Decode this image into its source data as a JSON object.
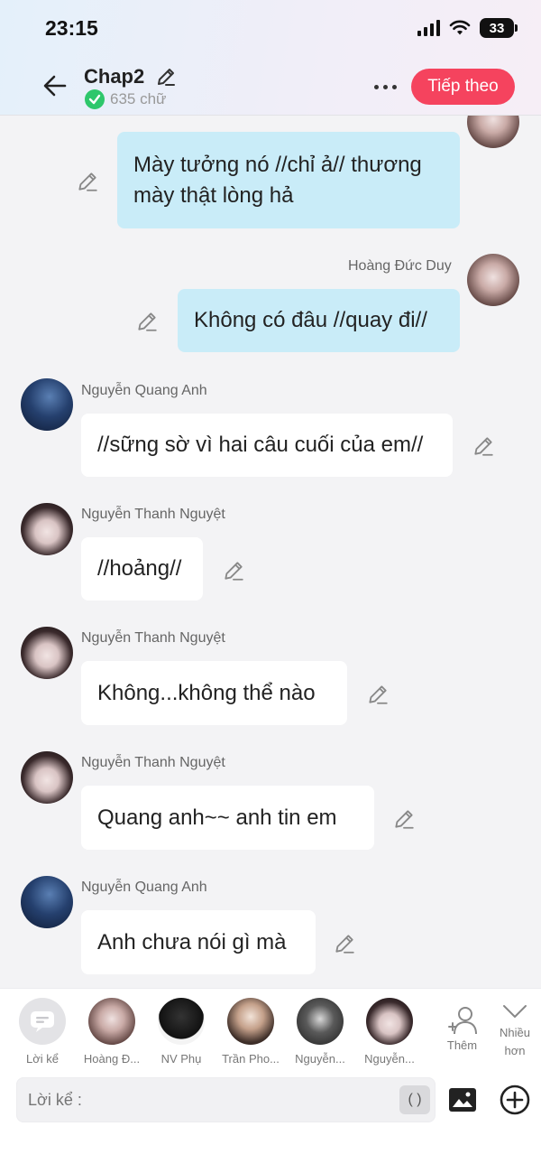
{
  "status_bar": {
    "time": "23:15",
    "battery": "33"
  },
  "header": {
    "title": "Chap2",
    "word_count": "635 chữ",
    "next_label": "Tiếp theo"
  },
  "messages": [
    {
      "side": "right",
      "sender": "",
      "text": "Mày tưởng nó //chỉ ả// thương mày thật lòng hả"
    },
    {
      "side": "right",
      "sender": "Hoàng Đức Duy",
      "text": "Không có đâu //quay đi//"
    },
    {
      "side": "left",
      "sender": "Nguyễn Quang Anh",
      "text": "//sững sờ vì hai câu cuối của em//"
    },
    {
      "side": "left",
      "sender": "Nguyễn Thanh Nguyệt",
      "text": "//hoảng//"
    },
    {
      "side": "left",
      "sender": "Nguyễn Thanh Nguyệt",
      "text": "Không...không thể nào"
    },
    {
      "side": "left",
      "sender": "Nguyễn Thanh Nguyệt",
      "text": "Quang anh~~ anh tin em"
    },
    {
      "side": "left",
      "sender": "Nguyễn Quang Anh",
      "text": "Anh chưa nói gì mà"
    }
  ],
  "characters": [
    {
      "label": "Lời kể",
      "icon": "narrator-chat-icon"
    },
    {
      "label": "Hoàng Đ..."
    },
    {
      "label": "NV Phụ"
    },
    {
      "label": "Trần Pho..."
    },
    {
      "label": "Nguyễn..."
    },
    {
      "label": "Nguyễn..."
    }
  ],
  "side_actions": {
    "add_label": "Thêm",
    "more_label": "Nhiều hơn",
    "more_label_line1": "Nhiều",
    "more_label_line2": "hơn"
  },
  "composer": {
    "placeholder": "Lời kể :",
    "paren_label": "( )"
  },
  "colors": {
    "accent": "#f5435e",
    "my_bubble": "#c9ecf8",
    "their_bubble": "#ffffff",
    "check": "#2ec76b"
  }
}
